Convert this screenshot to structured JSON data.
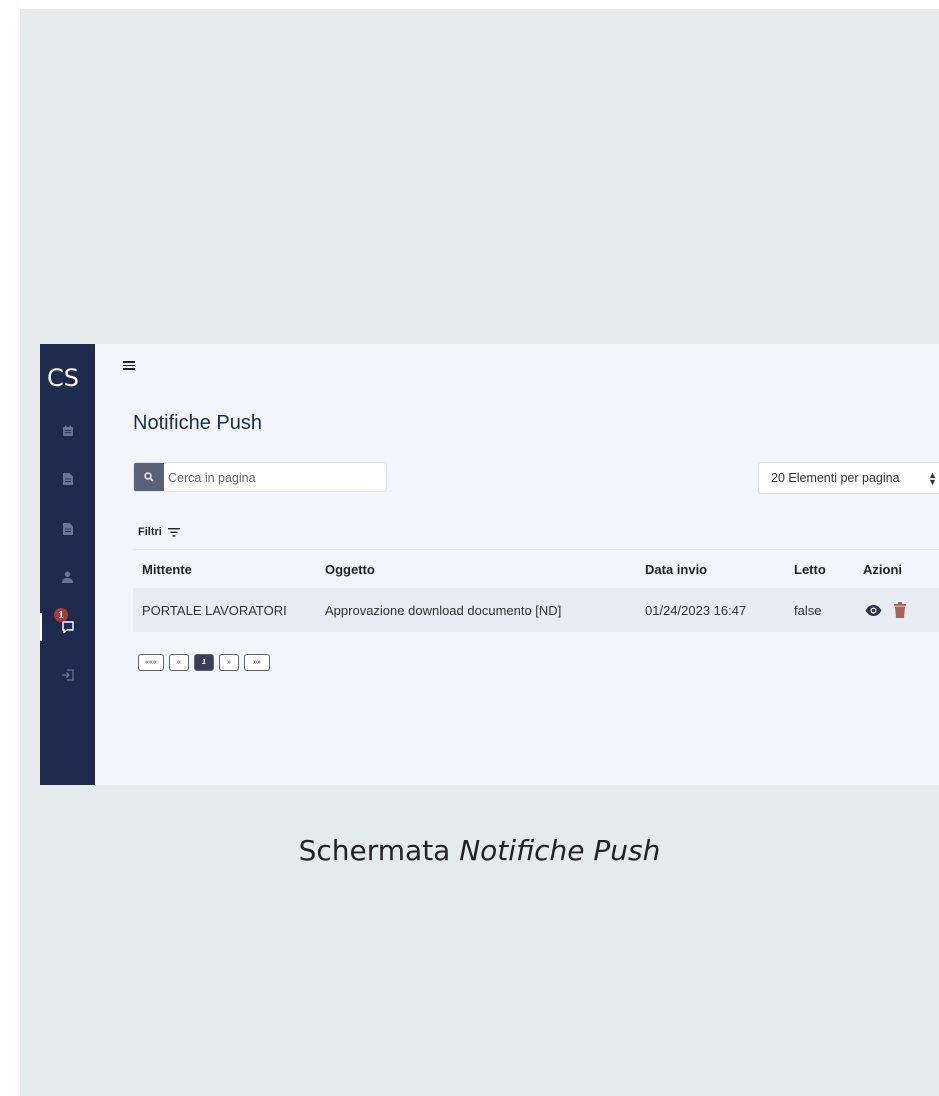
{
  "app": {
    "logo": "CS",
    "sidebar": {
      "items": [
        {
          "icon": "calendar-icon"
        },
        {
          "icon": "document-icon"
        },
        {
          "icon": "document-icon"
        },
        {
          "icon": "user-icon"
        },
        {
          "icon": "chat-icon",
          "badge": "1",
          "active": true
        },
        {
          "icon": "logout-icon"
        }
      ]
    },
    "page_title": "Notifiche Push",
    "search": {
      "placeholder": "Cerca in pagina"
    },
    "per_page": {
      "selected": "20 Elementi per pagina"
    },
    "filters_label": "Filtri",
    "table": {
      "headers": [
        "Mittente",
        "Oggetto",
        "Data invio",
        "Letto",
        "Azioni"
      ],
      "rows": [
        {
          "mittente": "PORTALE LAVORATORI",
          "oggetto": "Approvazione download documento [ND]",
          "data_invio": "01/24/2023 16:47",
          "letto": "false"
        }
      ]
    },
    "pager": {
      "first": "«««",
      "prev": "«",
      "current": "1",
      "next": "»",
      "last": "»»"
    }
  },
  "caption": {
    "prefix": "Schermata ",
    "emphasis": "Notifiche Push"
  },
  "colors": {
    "sidebar": "#1e2a4e",
    "badge": "#a83a3a",
    "delete": "#a9625b",
    "slide_bg": "#e5eaeb"
  }
}
